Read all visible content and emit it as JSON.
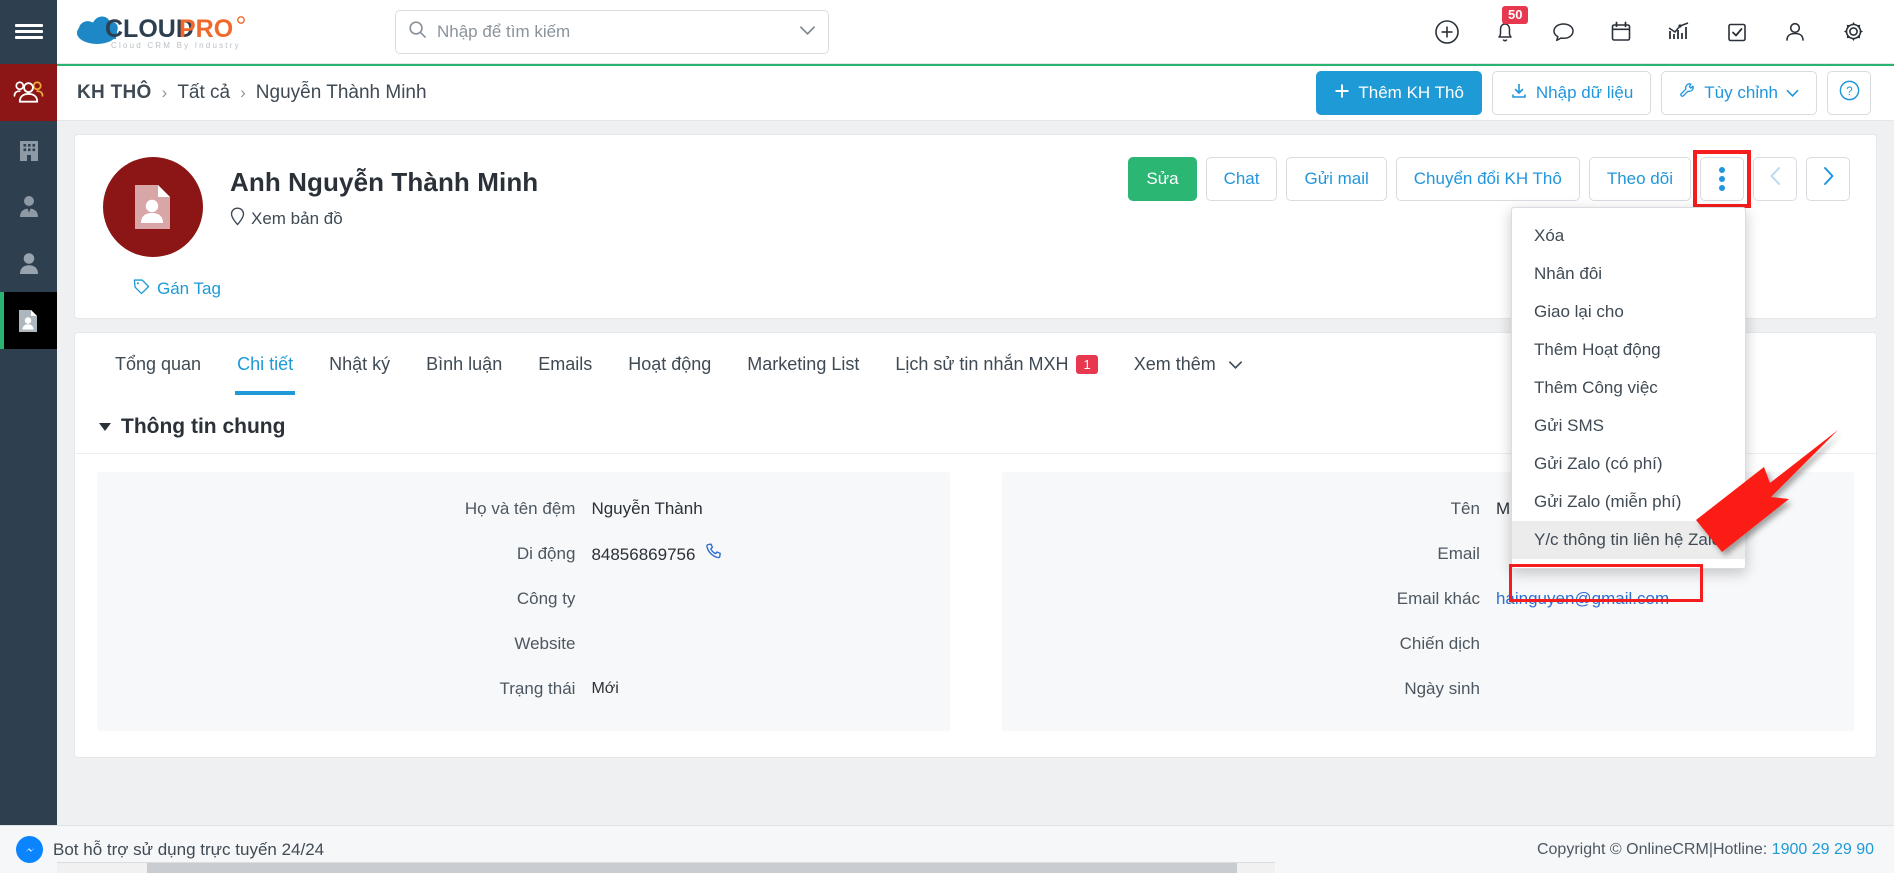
{
  "topbar": {
    "brand": "CLOUDPRO",
    "brand_tagline": "Cloud CRM By Industry",
    "search": {
      "value": "",
      "placeholder": "Nhập để tìm kiếm"
    },
    "icons": [
      {
        "name": "add-icon",
        "label": "Thêm mới"
      },
      {
        "name": "bell-icon",
        "label": "Thông báo",
        "badge": "50"
      },
      {
        "name": "chat-bubble-icon",
        "label": "Trò chuyện"
      },
      {
        "name": "calendar-icon",
        "label": "Lịch"
      },
      {
        "name": "chart-icon",
        "label": "Báo cáo"
      },
      {
        "name": "checkbox-icon",
        "label": "Công việc"
      },
      {
        "name": "user-icon",
        "label": "Tài khoản"
      },
      {
        "name": "gear-icon",
        "label": "Cài đặt"
      }
    ]
  },
  "breadcrumb": {
    "root": "KH THÔ",
    "separator": "›",
    "items": [
      "Tất cả",
      "Nguyễn Thành Minh"
    ],
    "actions": {
      "add": "Thêm KH Thô",
      "import": "Nhập dữ liệu",
      "customize": "Tùy chỉnh",
      "help": "?"
    }
  },
  "rail": {
    "items": [
      {
        "name": "sidebar-item-customers",
        "icon": "group-icon",
        "state": "active-red"
      },
      {
        "name": "sidebar-item-company",
        "icon": "building-icon",
        "state": "normal"
      },
      {
        "name": "sidebar-item-contact",
        "icon": "person-tie-icon",
        "state": "normal"
      },
      {
        "name": "sidebar-item-person",
        "icon": "person-icon",
        "state": "normal"
      },
      {
        "name": "sidebar-item-lead",
        "icon": "contact-card-icon",
        "state": "active-dark"
      }
    ]
  },
  "contact": {
    "name": "Anh Nguyễn Thành Minh",
    "view_map": "Xem bản đồ",
    "assign_tag": "Gán Tag",
    "avatar_icon": "contact-card-icon",
    "actions": {
      "edit": "Sửa",
      "chat": "Chat",
      "send_mail": "Gửi mail",
      "convert": "Chuyển đổi KH Thô",
      "follow": "Theo dõi",
      "more": "more-vertical-icon",
      "prev": "chevron-left-icon",
      "next": "chevron-right-icon"
    }
  },
  "tabs": [
    {
      "label": "Tổng quan",
      "active": false
    },
    {
      "label": "Chi tiết",
      "active": true
    },
    {
      "label": "Nhật ký",
      "active": false
    },
    {
      "label": "Bình luận",
      "active": false
    },
    {
      "label": "Emails",
      "active": false
    },
    {
      "label": "Hoạt động",
      "active": false
    },
    {
      "label": "Marketing List",
      "active": false
    },
    {
      "label": "Lịch sử tin nhắn MXH",
      "active": false,
      "badge": "1"
    },
    {
      "label": "Xem thêm",
      "active": false,
      "chevron": true
    }
  ],
  "panel": {
    "title": "Thông tin chung",
    "left_fields": [
      {
        "label": "Họ và tên đệm",
        "value": "Nguyễn Thành",
        "type": "text"
      },
      {
        "label": "Di động",
        "value": "84856869756",
        "type": "phone"
      },
      {
        "label": "Công ty",
        "value": "",
        "type": "text"
      },
      {
        "label": "Website",
        "value": "",
        "type": "text"
      },
      {
        "label": "Trạng thái",
        "value": "Mới",
        "type": "tag"
      }
    ],
    "right_fields": [
      {
        "label": "Tên",
        "value": "Minh",
        "type": "text"
      },
      {
        "label": "Email",
        "value": "",
        "type": "text"
      },
      {
        "label": "Email khác",
        "value": "hainguyen@gmail.com",
        "type": "link"
      },
      {
        "label": "Chiến dịch",
        "value": "",
        "type": "text"
      },
      {
        "label": "Ngày sinh",
        "value": "",
        "type": "text"
      }
    ]
  },
  "dropdown": {
    "items": [
      {
        "label": "Xóa",
        "highlighted": false
      },
      {
        "label": "Nhân đôi",
        "highlighted": false
      },
      {
        "label": "Giao lại cho",
        "highlighted": false
      },
      {
        "label": "Thêm Hoạt động",
        "highlighted": false
      },
      {
        "label": "Thêm Công việc",
        "highlighted": false
      },
      {
        "label": "Gửi SMS",
        "highlighted": false
      },
      {
        "label": "Gửi Zalo (có phí)",
        "highlighted": false
      },
      {
        "label": "Gửi Zalo (miễn phí)",
        "highlighted": false
      },
      {
        "label": "Y/c thông tin liên hệ Zalo",
        "highlighted": true
      }
    ]
  },
  "footer": {
    "bot_text": "Bot hỗ trợ sử dụng trực tuyến 24/24",
    "copyright": "Copyright © OnlineCRM|Hotline: ",
    "hotline": "1900 29 29 90"
  },
  "colors": {
    "brand_blue": "#1e9ad6",
    "brand_orange": "#f1682b",
    "accent_green": "#2bb673",
    "rail_dark": "#2e3f50",
    "rail_active_red": "#8c1515",
    "badge_red": "#e8384f",
    "annotation_red": "#f51d1d",
    "link_blue": "#2f6fd0"
  }
}
